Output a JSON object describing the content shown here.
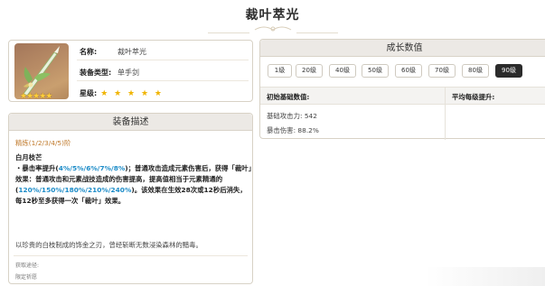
{
  "page": {
    "title": "裁叶萃光"
  },
  "weapon_info": {
    "rows": [
      {
        "label": "名称:",
        "value": "裁叶萃光"
      },
      {
        "label": "装备类型:",
        "value": "单手剑"
      },
      {
        "label": "星级:",
        "value": ""
      }
    ],
    "rarity": 5,
    "rarity_stars": "★ ★ ★ ★ ★",
    "thumb_stars": "★★★★★",
    "colors": {
      "star": "#f0b400",
      "thumb_bg": "#b98d66"
    }
  },
  "description": {
    "header": "装备描述",
    "refine_label": "精炼(1/2/3/4/5)阶",
    "skill_name": "白月枝芒",
    "skill_parts": [
      {
        "text": "・暴击率提升(",
        "hl": false
      },
      {
        "text": "4%/5%/6%/7%/8%",
        "hl": true
      },
      {
        "text": ")；普通攻击造成元素伤害后，获得「裁叶」效果：普通攻击和元素战技造成的伤害提高，提高值相当于元素精通的(",
        "hl": false
      },
      {
        "text": "120%/150%/180%/210%/240%",
        "hl": true
      },
      {
        "text": ")。该效果在生效28次或12秒后消失，每12秒至多获得一次「裁叶」效果。",
        "hl": false
      }
    ],
    "flavor": "以珍贵的白枝制成的饰金之刃，曾经斩断无数浸染森林的黯毒。",
    "obtain_label": "获取途径:",
    "obtain_value": "限定祈愿",
    "colors": {
      "highlight": "#1d8cc8",
      "refine": "#c07a2c"
    }
  },
  "growth": {
    "header": "成长数值",
    "levels": [
      "1级",
      "20级",
      "40级",
      "50级",
      "60级",
      "70级",
      "80级",
      "90级"
    ],
    "active_level": "90级",
    "col1_header": "初始基础数值:",
    "col2_header": "平均每级提升:",
    "stats": [
      {
        "label": "基础攻击力:",
        "value": "542"
      },
      {
        "label": "暴击伤害:",
        "value": "88.2%"
      }
    ]
  }
}
